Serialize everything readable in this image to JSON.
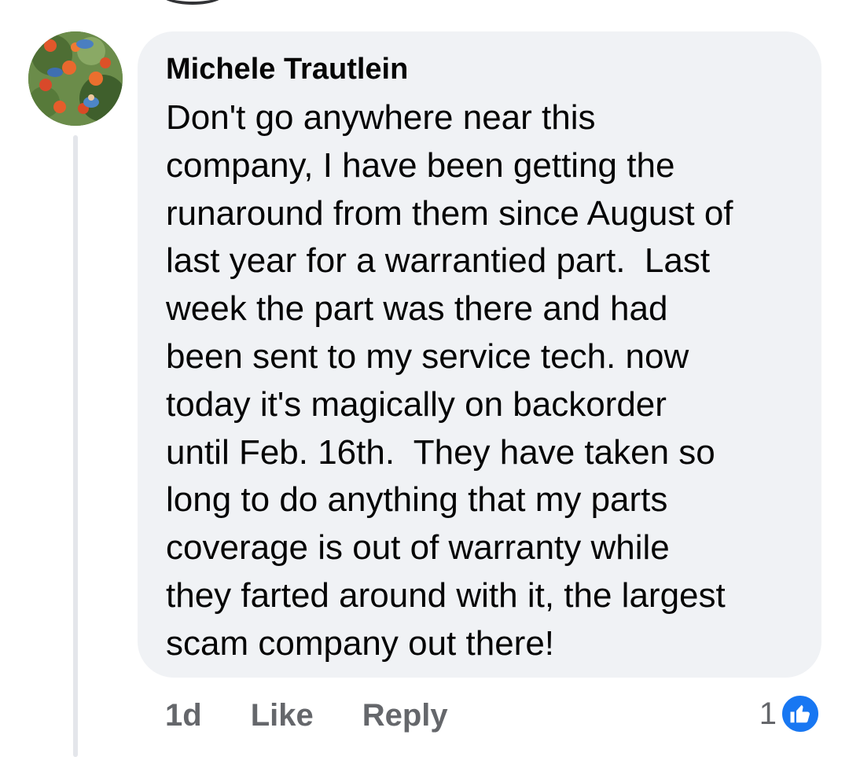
{
  "comment": {
    "author": "Michele Trautlein",
    "text_lines": [
      "Don't go anywhere near this",
      "company, I have been getting the",
      "runaround from them since August of",
      "last year for a warrantied part.  Last",
      "week the part was there and had",
      "been sent to my service tech. now",
      "today it's magically on backorder",
      "until Feb. 16th.  They have taken so",
      "long to do anything that my parts",
      "coverage is out of warranty while",
      "they farted around with it, the largest",
      "scam company out there!"
    ],
    "timestamp": "1d",
    "like_label": "Like",
    "reply_label": "Reply",
    "reaction_count": "1",
    "reaction_icon": "thumbs-up-icon",
    "avatar_icon": "profile-avatar-birds-oranges"
  },
  "colors": {
    "bubble_bg": "#f0f2f5",
    "text": "#050505",
    "secondary_text": "#65676b",
    "like_blue": "#1877f2",
    "thread_line": "#e4e6eb"
  }
}
